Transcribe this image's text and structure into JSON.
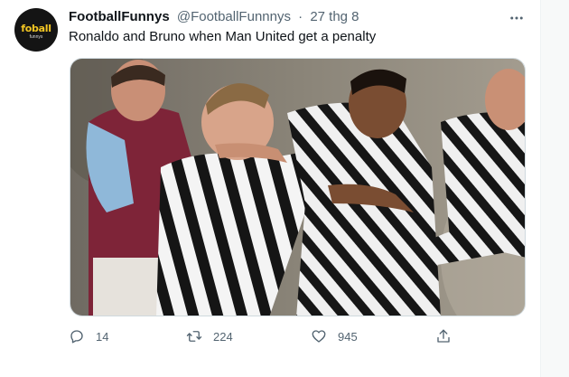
{
  "tweet": {
    "avatar": {
      "logo_text": "fo",
      "logo_text_accent": "ball",
      "logo_subtext": "funnys"
    },
    "display_name": "FootballFunnys",
    "handle": "@FootballFunnnys",
    "separator": "·",
    "timestamp": "27 thg 8",
    "text": "Ronaldo and Bruno when Man United get a penalty",
    "media": {
      "kind": "photo"
    },
    "actions": {
      "reply_count": "14",
      "retweet_count": "224",
      "like_count": "945"
    }
  },
  "icons": {
    "more": "more-horizontal-icon",
    "reply": "reply-icon",
    "retweet": "retweet-icon",
    "like": "heart-icon",
    "share": "share-icon"
  },
  "colors": {
    "text_primary": "#0f1419",
    "text_secondary": "#536471",
    "border": "#cfd9de",
    "logo_yellow": "#f3c623"
  }
}
